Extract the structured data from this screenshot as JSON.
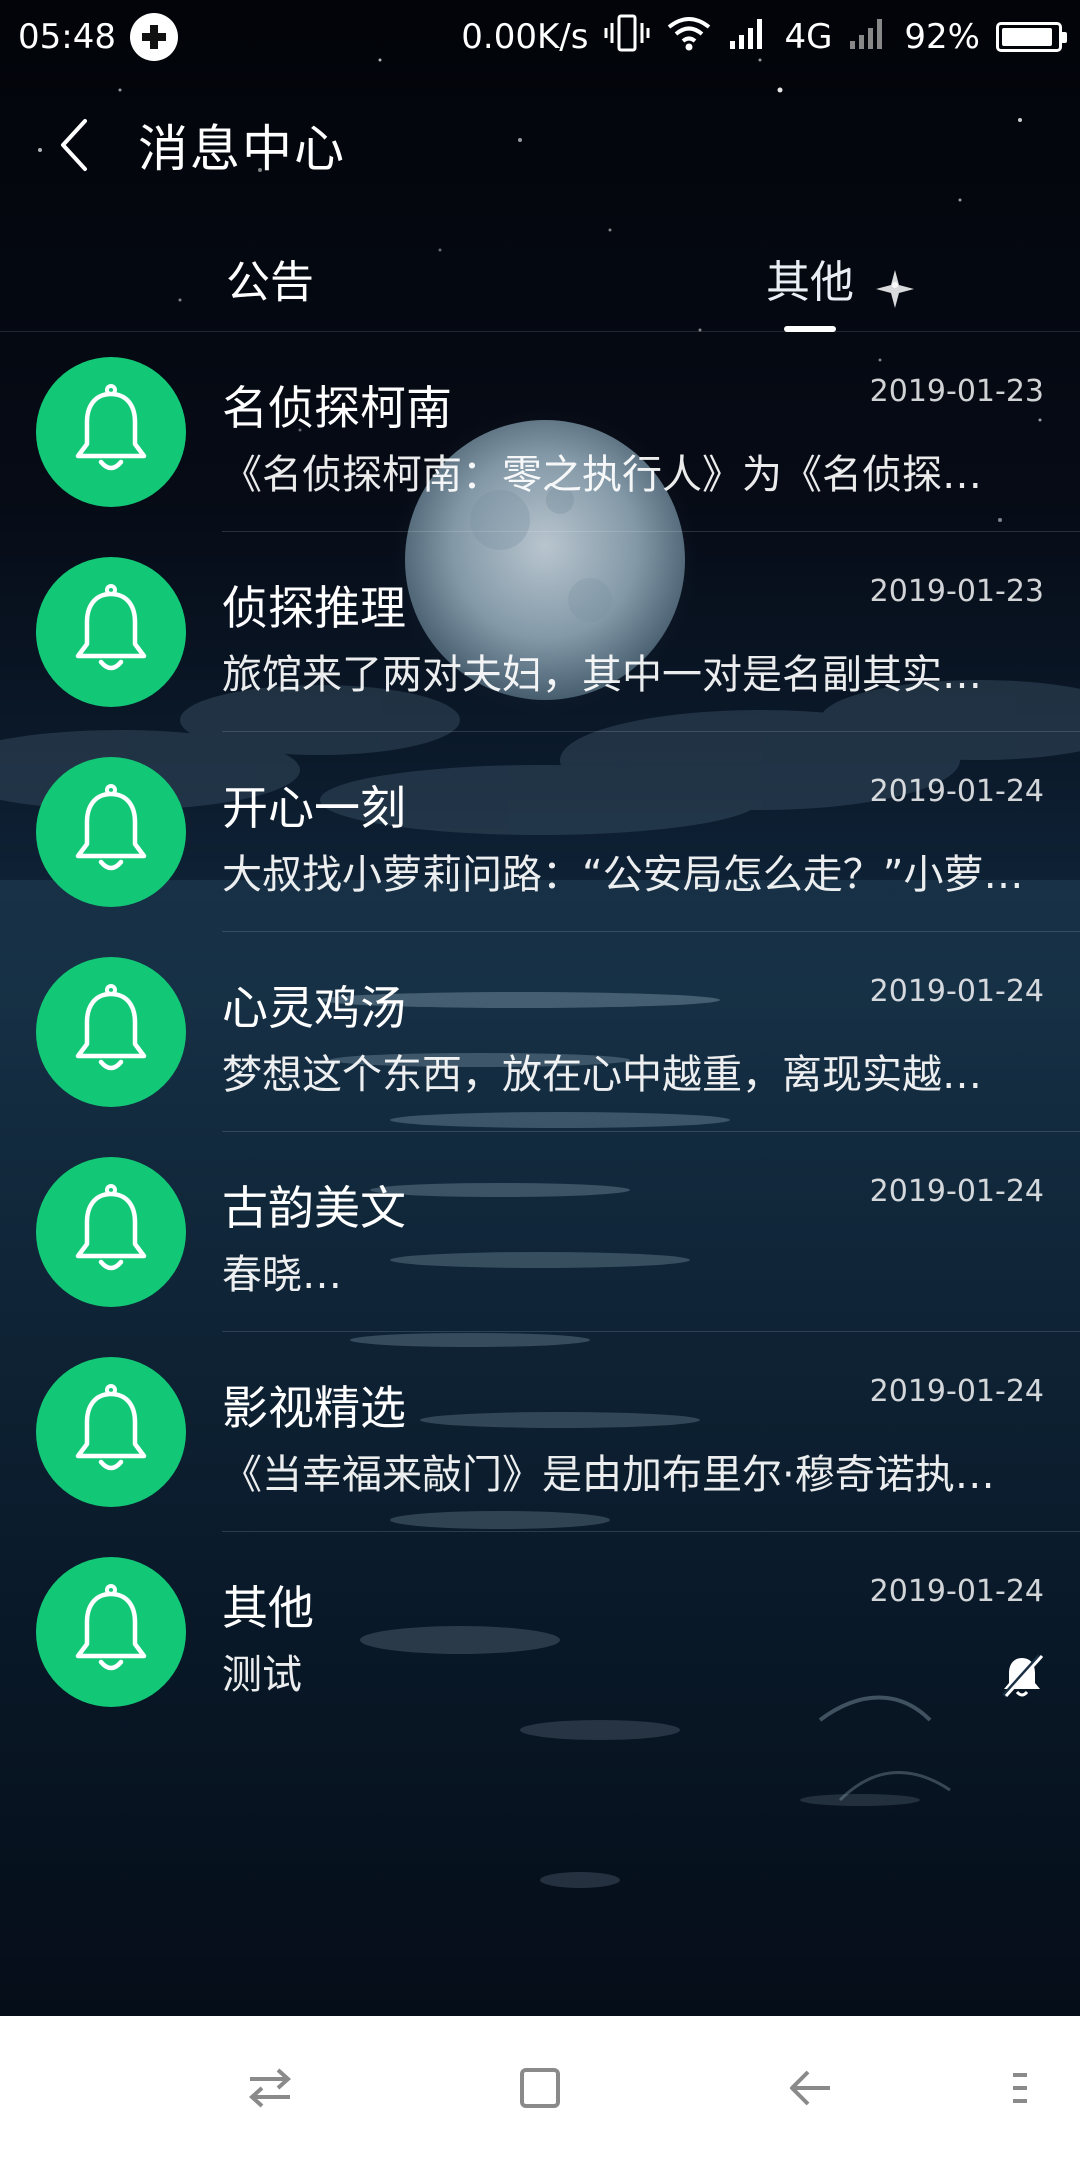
{
  "status_bar": {
    "time": "05:48",
    "net_speed": "0.00K/s",
    "network_type": "4G",
    "battery": "92%",
    "battery_level": 0.92,
    "icons": [
      "plus-circle-icon",
      "vibrate-icon",
      "wifi-icon",
      "signal-icon",
      "signal-weak-icon",
      "battery-icon"
    ]
  },
  "header": {
    "title": "消息中心",
    "back_icon": "chevron-left-icon"
  },
  "tabs": [
    {
      "label": "公告",
      "active": false
    },
    {
      "label": "其他",
      "active": true
    }
  ],
  "messages": [
    {
      "title": "名侦探柯南",
      "date": "2019-01-23",
      "preview": "《名侦探柯南：零之执行人》为《名侦探…",
      "muted": false,
      "icon": "bell-icon"
    },
    {
      "title": "侦探推理",
      "date": "2019-01-23",
      "preview": "旅馆来了两对夫妇，其中一对是名副其实…",
      "muted": false,
      "icon": "bell-icon"
    },
    {
      "title": "开心一刻",
      "date": "2019-01-24",
      "preview": "大叔找小萝莉问路：“公安局怎么走？”小萝…",
      "muted": false,
      "icon": "bell-icon"
    },
    {
      "title": "心灵鸡汤",
      "date": "2019-01-24",
      "preview": "梦想这个东西，放在心中越重，离现实越…",
      "muted": false,
      "icon": "bell-icon"
    },
    {
      "title": "古韵美文",
      "date": "2019-01-24",
      "preview": "春晓…",
      "muted": false,
      "icon": "bell-icon"
    },
    {
      "title": "影视精选",
      "date": "2019-01-24",
      "preview": "《当幸福来敲门》是由加布里尔·穆奇诺执…",
      "muted": false,
      "icon": "bell-icon"
    },
    {
      "title": "其他",
      "date": "2019-01-24",
      "preview": "测试",
      "muted": true,
      "icon": "bell-icon"
    }
  ],
  "colors": {
    "avatar_bg": "#12c877",
    "nav_bg": "#ffffff",
    "nav_icon": "#8a8a8a"
  },
  "nav_bar": {
    "icons": [
      "switch-icon",
      "home-square-icon",
      "back-arrow-icon",
      "menu-icon"
    ]
  }
}
